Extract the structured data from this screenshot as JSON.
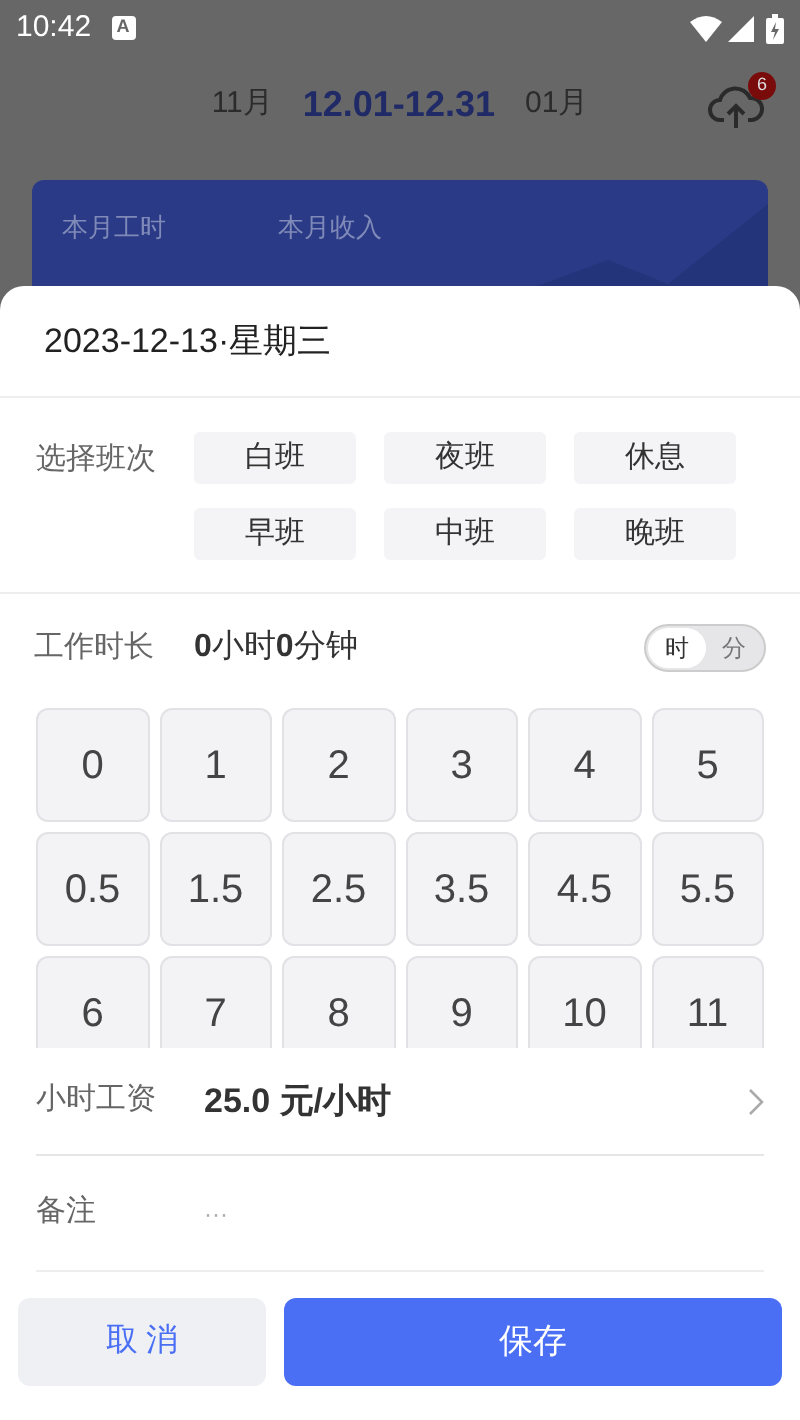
{
  "status_bar": {
    "time": "10:42",
    "notice": "A"
  },
  "header": {
    "prev": "11月",
    "current": "12.01-12.31",
    "next": "01月",
    "upload_badge": "6"
  },
  "summary_card": {
    "items": [
      {
        "label": "本月工时"
      },
      {
        "label": "本月收入"
      }
    ]
  },
  "sheet": {
    "date": "2023-12-13·星期三",
    "shift": {
      "label": "选择班次",
      "options": [
        "白班",
        "夜班",
        "休息",
        "早班",
        "中班",
        "晚班"
      ]
    },
    "duration": {
      "label": "工作时长",
      "parts": [
        {
          "kind": "number",
          "text": "0"
        },
        {
          "kind": "unit",
          "text": "小时"
        },
        {
          "kind": "number",
          "text": "0"
        },
        {
          "kind": "unit",
          "text": "分钟"
        }
      ],
      "units": [
        {
          "label": "时",
          "selected": true
        },
        {
          "label": "分",
          "selected": false
        }
      ]
    },
    "keys": [
      "0",
      "1",
      "2",
      "3",
      "4",
      "5",
      "0.5",
      "1.5",
      "2.5",
      "3.5",
      "4.5",
      "5.5",
      "6",
      "7",
      "8",
      "9",
      "10",
      "11"
    ],
    "wage": {
      "label": "小时工资",
      "value": "25.0 元/小时"
    },
    "remark": {
      "label": "备注",
      "placeholder": "···"
    },
    "buttons": [
      {
        "kind": "secondary",
        "label": "取 消"
      },
      {
        "kind": "primary",
        "label": "保存"
      }
    ]
  }
}
